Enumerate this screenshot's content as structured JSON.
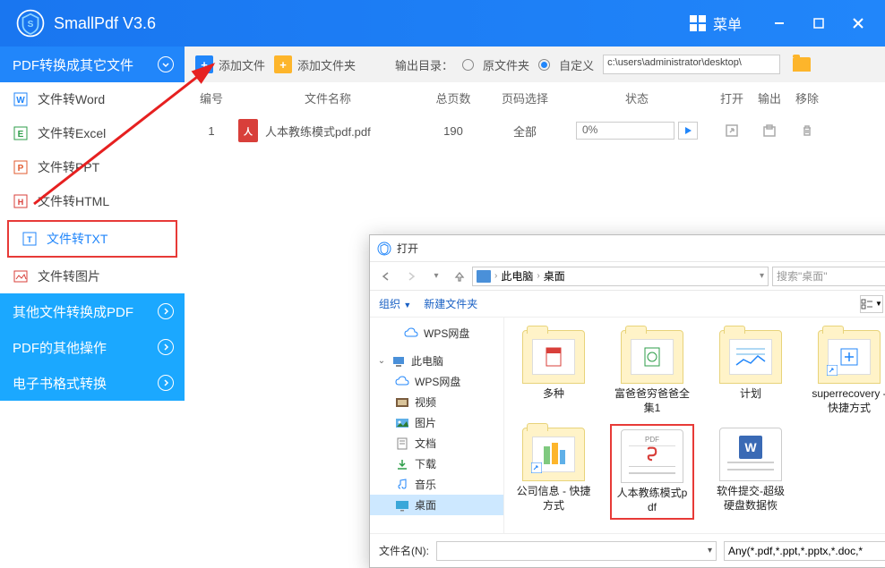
{
  "titlebar": {
    "app_title": "SmallPdf V3.6",
    "menu_label": "菜单"
  },
  "sidebar": {
    "cat1": "PDF转换成其它文件",
    "items": [
      {
        "label": "文件转Word"
      },
      {
        "label": "文件转Excel"
      },
      {
        "label": "文件转PPT"
      },
      {
        "label": "文件转HTML"
      },
      {
        "label": "文件转TXT"
      },
      {
        "label": "文件转图片"
      }
    ],
    "cat2": "其他文件转换成PDF",
    "cat3": "PDF的其他操作",
    "cat4": "电子书格式转换"
  },
  "toolbar": {
    "add_file": "添加文件",
    "add_folder": "添加文件夹",
    "output_label": "输出目录：",
    "radio_original": "原文件夹",
    "radio_custom": "自定义",
    "path": "c:\\users\\administrator\\desktop\\"
  },
  "table": {
    "headers": {
      "idx": "编号",
      "name": "文件名称",
      "pages": "总页数",
      "sel": "页码选择",
      "status": "状态",
      "open": "打开",
      "out": "输出",
      "del": "移除"
    },
    "rows": [
      {
        "idx": "1",
        "name": "人本教练模式pdf.pdf",
        "pages": "190",
        "sel": "全部",
        "pct": "0%"
      }
    ]
  },
  "dialog": {
    "title": "打开",
    "breadcrumb": {
      "pc": "此电脑",
      "desktop": "桌面"
    },
    "search_placeholder": "搜索\"桌面\"",
    "organize": "组织",
    "new_folder": "新建文件夹",
    "tree": [
      {
        "label": "WPS网盘",
        "type": "cloud"
      },
      {
        "label": "此电脑",
        "type": "pc"
      },
      {
        "label": "WPS网盘",
        "type": "cloud",
        "indent": true
      },
      {
        "label": "视频",
        "type": "video",
        "indent": true
      },
      {
        "label": "图片",
        "type": "image",
        "indent": true
      },
      {
        "label": "文档",
        "type": "doc",
        "indent": true
      },
      {
        "label": "下载",
        "type": "download",
        "indent": true
      },
      {
        "label": "音乐",
        "type": "music",
        "indent": true
      },
      {
        "label": "桌面",
        "type": "desktop",
        "indent": true,
        "sel": true
      }
    ],
    "files": [
      {
        "label": "多种",
        "type": "folder-pdf"
      },
      {
        "label": "富爸爸穷爸爸全集1",
        "type": "folder-pdf"
      },
      {
        "label": "计划",
        "type": "folder-chart"
      },
      {
        "label": "superrecovery - 快捷方式",
        "type": "folder-shortcut"
      },
      {
        "label": "公司信息 - 快捷方式",
        "type": "folder-shortcut2"
      },
      {
        "label": "人本教练模式pdf",
        "type": "pdf",
        "selected": true
      },
      {
        "label": "软件提交-超级硬盘数据恢",
        "type": "word"
      }
    ],
    "filename_label": "文件名(N):",
    "filetype": "Any(*.pdf,*.ppt,*.pptx,*.doc,*"
  }
}
